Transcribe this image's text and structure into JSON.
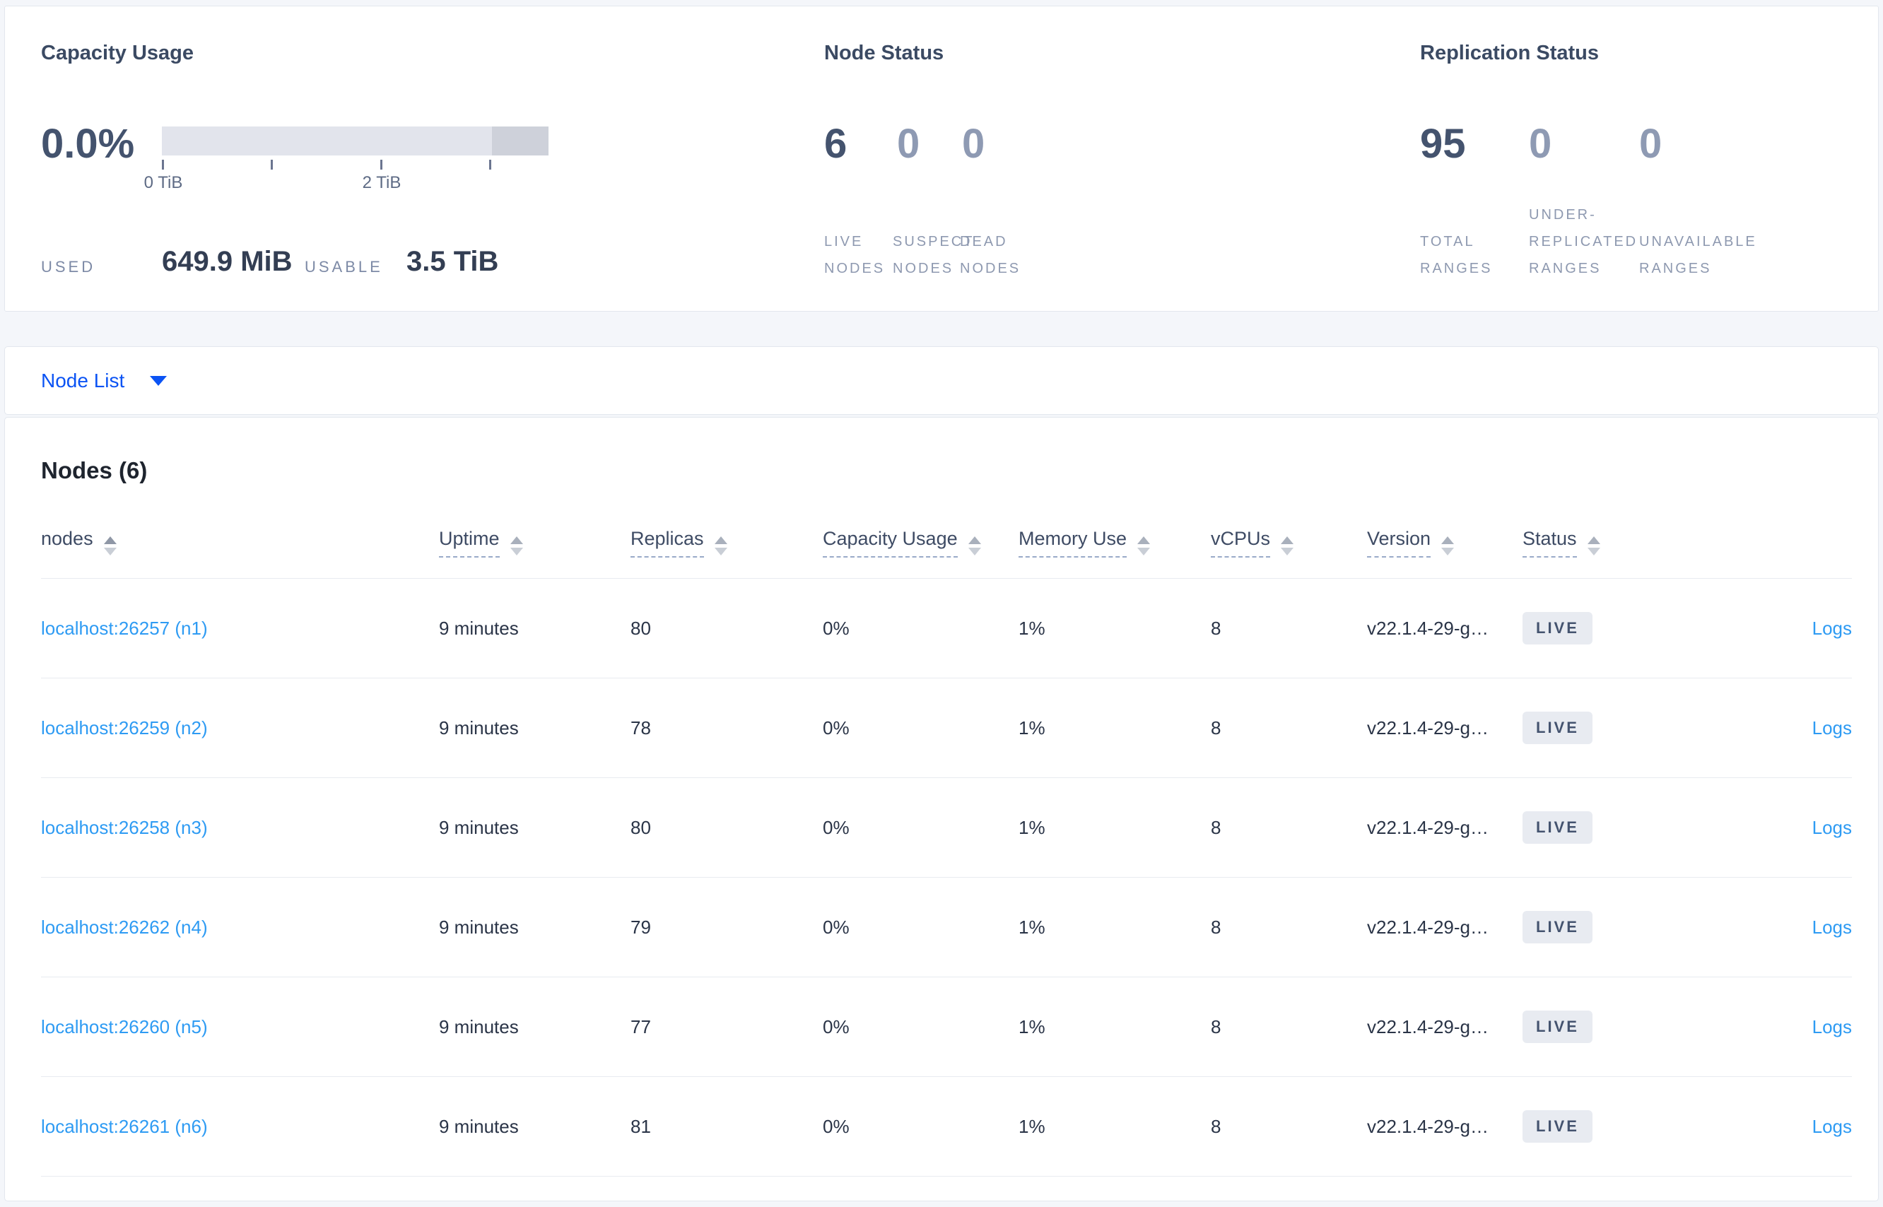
{
  "colors": {
    "accent_blue": "#0b53f4",
    "link_blue": "#2e9bf3",
    "badge_bg": "#e8ebf1",
    "badge_text": "#44536f"
  },
  "capacity": {
    "title": "Capacity Usage",
    "percent": "0.0%",
    "tick_label_0": "0 TiB",
    "tick_label_2": "2 TiB",
    "used_label": "USED",
    "used_value": "649.9 MiB",
    "usable_label": "USABLE",
    "usable_value": "3.5 TiB"
  },
  "node_status": {
    "title": "Node Status",
    "stats": [
      {
        "value": "6",
        "label": "LIVE NODES"
      },
      {
        "value": "0",
        "label": "SUSPECT NODES"
      },
      {
        "value": "0",
        "label": "DEAD NODES"
      }
    ]
  },
  "replication_status": {
    "title": "Replication Status",
    "stats": [
      {
        "value": "95",
        "label": "TOTAL RANGES"
      },
      {
        "value": "0",
        "label": "UNDER-REPLICATED RANGES"
      },
      {
        "value": "0",
        "label": "UNAVAILABLE RANGES"
      }
    ]
  },
  "node_list": {
    "selected": "Node List"
  },
  "nodes_table": {
    "title": "Nodes (6)",
    "headers": {
      "nodes": "nodes",
      "uptime": "Uptime",
      "replicas": "Replicas",
      "capacity": "Capacity Usage",
      "memory": "Memory Use",
      "vcpus": "vCPUs",
      "version": "Version",
      "status": "Status"
    },
    "rows": [
      {
        "address": "localhost:26257 (n1)",
        "uptime": "9 minutes",
        "replicas": "80",
        "capacity": "0%",
        "memory": "1%",
        "vcpus": "8",
        "version": "v22.1.4-29-g…",
        "status": "LIVE",
        "logs": "Logs"
      },
      {
        "address": "localhost:26259 (n2)",
        "uptime": "9 minutes",
        "replicas": "78",
        "capacity": "0%",
        "memory": "1%",
        "vcpus": "8",
        "version": "v22.1.4-29-g…",
        "status": "LIVE",
        "logs": "Logs"
      },
      {
        "address": "localhost:26258 (n3)",
        "uptime": "9 minutes",
        "replicas": "80",
        "capacity": "0%",
        "memory": "1%",
        "vcpus": "8",
        "version": "v22.1.4-29-g…",
        "status": "LIVE",
        "logs": "Logs"
      },
      {
        "address": "localhost:26262 (n4)",
        "uptime": "9 minutes",
        "replicas": "79",
        "capacity": "0%",
        "memory": "1%",
        "vcpus": "8",
        "version": "v22.1.4-29-g…",
        "status": "LIVE",
        "logs": "Logs"
      },
      {
        "address": "localhost:26260 (n5)",
        "uptime": "9 minutes",
        "replicas": "77",
        "capacity": "0%",
        "memory": "1%",
        "vcpus": "8",
        "version": "v22.1.4-29-g…",
        "status": "LIVE",
        "logs": "Logs"
      },
      {
        "address": "localhost:26261 (n6)",
        "uptime": "9 minutes",
        "replicas": "81",
        "capacity": "0%",
        "memory": "1%",
        "vcpus": "8",
        "version": "v22.1.4-29-g…",
        "status": "LIVE",
        "logs": "Logs"
      }
    ]
  }
}
